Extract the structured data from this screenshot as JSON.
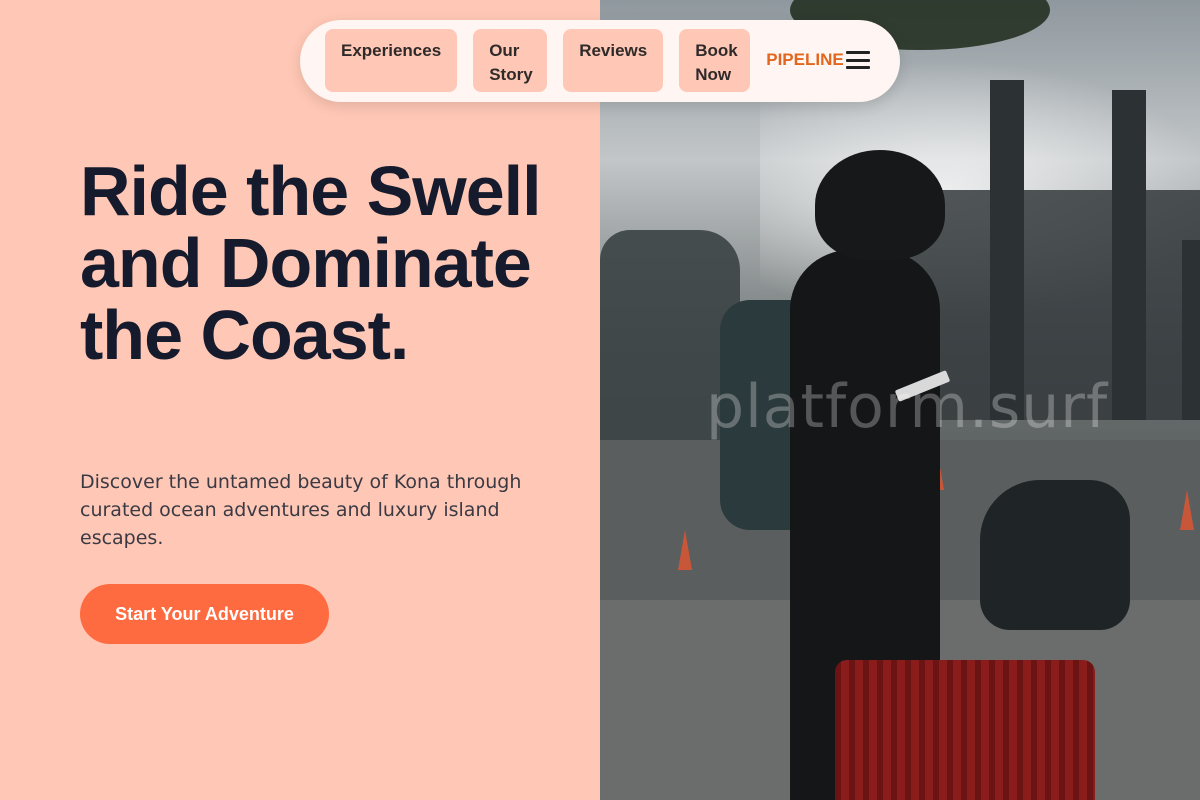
{
  "nav": {
    "items": [
      {
        "label": "Experiences"
      },
      {
        "label": "Our Story"
      },
      {
        "label": "Reviews"
      },
      {
        "label": "Book Now"
      }
    ],
    "brand": "PIPELINE",
    "menu_icon": "hamburger-menu-icon"
  },
  "hero": {
    "title": "Ride the Swell and Dominate the Coast.",
    "subtitle": "Discover the untamed beauty of Kona through curated ocean adventures and luxury island escapes.",
    "cta_label": "Start Your Adventure"
  },
  "image": {
    "watermark": "platform.surf"
  },
  "colors": {
    "background": "#FFC7B5",
    "accent": "#FF6B40",
    "brand": "#E2661E",
    "heading": "#151a2c",
    "nav_bg": "#FFF5F2"
  }
}
